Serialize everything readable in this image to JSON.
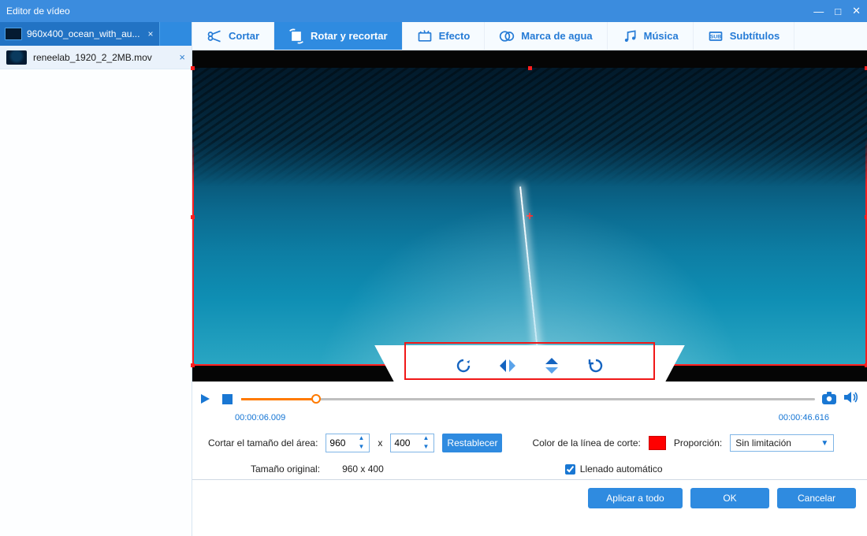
{
  "window": {
    "title": "Editor de vídeo"
  },
  "sidebar": {
    "active_tab": "960x400_ocean_with_au...",
    "files": [
      {
        "name": "reneelab_1920_2_2MB.mov"
      }
    ]
  },
  "tooltabs": {
    "cut": "Cortar",
    "rotate": "Rotar y recortar",
    "effect": "Efecto",
    "watermark": "Marca de agua",
    "music": "Música",
    "subtitles": "Subtítulos",
    "active": "rotate"
  },
  "transport": {
    "current": "00:00:06.009",
    "total": "00:00:46.616",
    "progress_pct": 13
  },
  "settings": {
    "crop_size_label": "Cortar el tamaño del área:",
    "width": "960",
    "height": "400",
    "x_sep": "x",
    "reset": "Restablecer",
    "cut_color_label": "Color de la línea de corte:",
    "cut_color": "#ff0000",
    "ratio_label": "Proporción:",
    "ratio_value": "Sin limitación",
    "orig_size_label": "Tamaño original:",
    "orig_size_value": "960 x 400",
    "autofill_label": "Llenado automático",
    "autofill_checked": true
  },
  "footer": {
    "apply_all": "Aplicar a todo",
    "ok": "OK",
    "cancel": "Cancelar"
  },
  "icons": {
    "minimize": "—",
    "maximize": "□",
    "close": "✕"
  }
}
